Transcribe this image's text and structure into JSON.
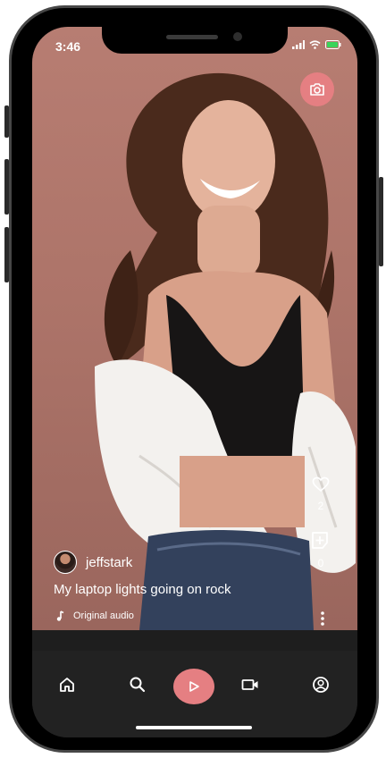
{
  "status_bar": {
    "time": "3:46"
  },
  "post": {
    "username": "jeffstark",
    "caption": "My laptop lights going on rock",
    "audio": "Original audio",
    "likes": "2",
    "saves": "0"
  },
  "icons": {
    "camera": "camera-icon",
    "like": "heart-icon",
    "save": "add-box-icon",
    "more": "more-vertical-icon",
    "music": "music-note-icon",
    "home": "home-icon",
    "search": "search-icon",
    "play": "play-icon",
    "video": "video-camera-icon",
    "profile": "account-circle-icon"
  },
  "colors": {
    "accent": "#e57f82",
    "nav_background": "#222222"
  }
}
